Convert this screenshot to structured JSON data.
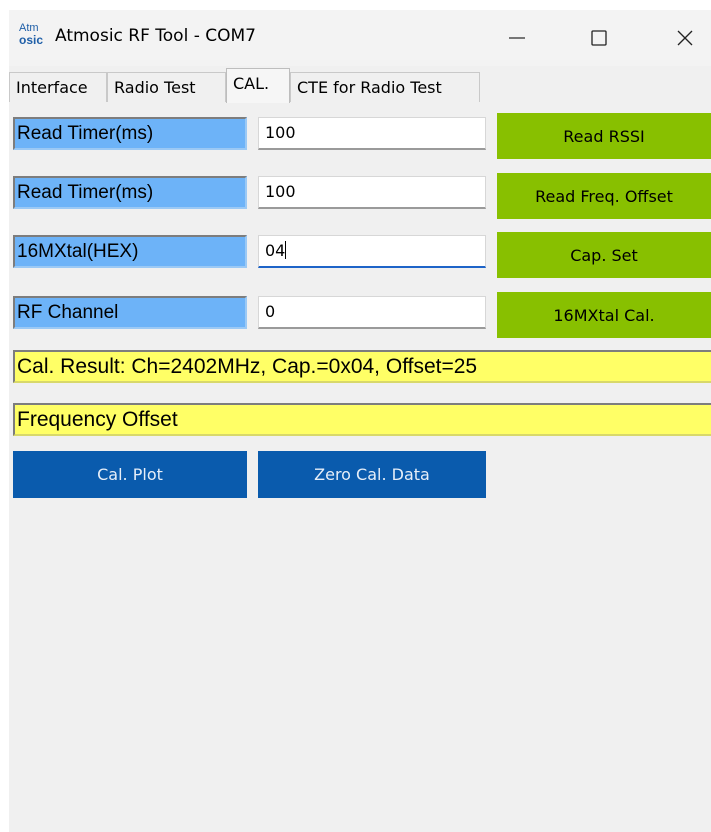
{
  "window": {
    "logo_line1": "Atm",
    "logo_line2": "osic",
    "title": "Atmosic RF Tool - COM7",
    "minimize": "—",
    "maximize": "☐",
    "close": "✕"
  },
  "tabs": [
    {
      "label": "Interface",
      "active": false
    },
    {
      "label": "Radio Test",
      "active": false
    },
    {
      "label": "CAL.",
      "active": true
    },
    {
      "label": "CTE for Radio Test",
      "active": false
    }
  ],
  "rows": [
    {
      "label": "Read Timer(ms)",
      "value": "100",
      "button": "Read RSSI"
    },
    {
      "label": "Read Timer(ms)",
      "value": "100",
      "button": "Read Freq. Offset"
    },
    {
      "label": "16MXtal(HEX)",
      "value": "04",
      "button": "Cap. Set"
    },
    {
      "label": "RF Channel",
      "value": "0",
      "button": "16MXtal Cal."
    }
  ],
  "result_text": "Cal. Result: Ch=2402MHz, Cap.=0x04, Offset=25",
  "mode_text": "Frequency Offset",
  "actions": {
    "cal_plot": "Cal. Plot",
    "zero_cal": "Zero Cal. Data"
  },
  "colors": {
    "label_blue": "#6db3f8",
    "button_green": "#88c000",
    "result_yellow": "#ffff66",
    "action_blue": "#0a5bad"
  }
}
